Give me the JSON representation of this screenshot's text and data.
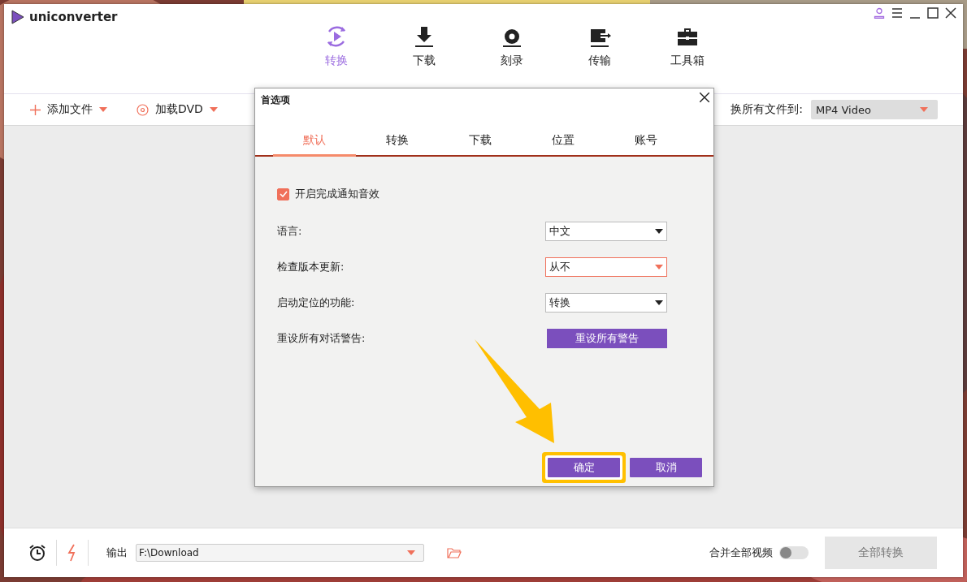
{
  "app": {
    "name": "uniconverter"
  },
  "nav": [
    {
      "label": "转换",
      "selected": true
    },
    {
      "label": "下载",
      "selected": false
    },
    {
      "label": "刻录",
      "selected": false
    },
    {
      "label": "传输",
      "selected": false
    },
    {
      "label": "工具箱",
      "selected": false
    }
  ],
  "toolbar": {
    "add_files": "添加文件",
    "load_dvd": "加载DVD",
    "convert_all_label": "换所有文件到:",
    "format": "MP4 Video"
  },
  "dialog": {
    "title": "首选项",
    "tabs": [
      {
        "label": "默认",
        "selected": true
      },
      {
        "label": "转换",
        "selected": false
      },
      {
        "label": "下载",
        "selected": false
      },
      {
        "label": "位置",
        "selected": false
      },
      {
        "label": "账号",
        "selected": false
      }
    ],
    "notify": {
      "label": "开启完成通知音效",
      "checked": true
    },
    "settings": [
      {
        "kind": "select",
        "label": "语言:",
        "value": "中文",
        "focused": false
      },
      {
        "kind": "select",
        "label": "检查版本更新:",
        "value": "从不",
        "focused": true
      },
      {
        "kind": "select",
        "label": "启动定位的功能:",
        "value": "转换",
        "focused": false
      },
      {
        "kind": "button",
        "label": "重设所有对话警告:",
        "value": "重设所有警告"
      }
    ],
    "buttons": [
      {
        "label": "确定",
        "highlighted": true
      },
      {
        "label": "取消",
        "highlighted": false
      }
    ]
  },
  "footer": {
    "output_label": "输出",
    "output_path": "F:\\Download",
    "merge_label": "合并全部视频",
    "merge_on": false,
    "convert_all": "全部转换",
    "convert_all_disabled": true
  }
}
